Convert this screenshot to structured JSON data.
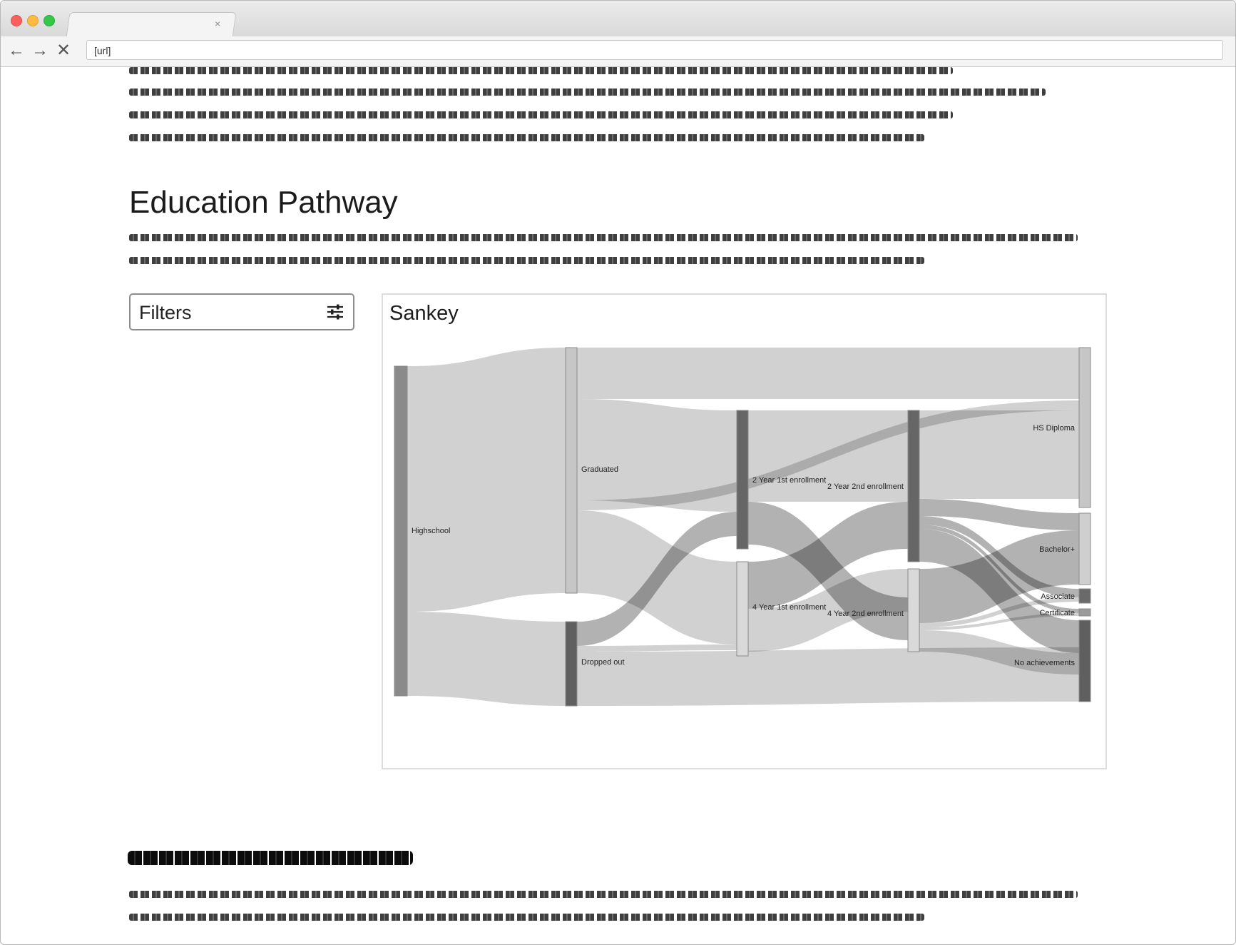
{
  "browser": {
    "tab_close": "×",
    "url": "[url]",
    "back_icon": "←",
    "forward_icon": "→",
    "stop_icon": "✕"
  },
  "page": {
    "title": "Education Pathway"
  },
  "filters": {
    "label": "Filters",
    "icon": "sliders-icon"
  },
  "sankey": {
    "title": "Sankey",
    "nodes": [
      {
        "id": "highschool",
        "label": "Highschool",
        "col": 0,
        "shade": "#8a8a8a"
      },
      {
        "id": "graduated",
        "label": "Graduated",
        "col": 1,
        "shade": "#c6c6c6"
      },
      {
        "id": "dropped",
        "label": "Dropped out",
        "col": 1,
        "shade": "#5f5f5f"
      },
      {
        "id": "y2first",
        "label": "2 Year 1st enrollment",
        "col": 2,
        "shade": "#666666"
      },
      {
        "id": "y4first",
        "label": "4 Year 1st enrollment",
        "col": 2,
        "shade": "#d9d9d9"
      },
      {
        "id": "y2second",
        "label": "2 Year 2nd enrollment",
        "col": 3,
        "shade": "#666666"
      },
      {
        "id": "y4second",
        "label": "4 Year 2nd enrollment",
        "col": 3,
        "shade": "#d9d9d9"
      },
      {
        "id": "hs",
        "label": "HS Diploma",
        "col": 4,
        "shade": "#c6c6c6"
      },
      {
        "id": "bach",
        "label": "Bachelor+",
        "col": 4,
        "shade": "#cfcfcf"
      },
      {
        "id": "assoc",
        "label": "Associate",
        "col": 4,
        "shade": "#6a6a6a"
      },
      {
        "id": "cert",
        "label": "Certificate",
        "col": 4,
        "shade": "#9a9a9a"
      },
      {
        "id": "none",
        "label": "No achievements",
        "col": 4,
        "shade": "#5f5f5f"
      }
    ]
  }
}
